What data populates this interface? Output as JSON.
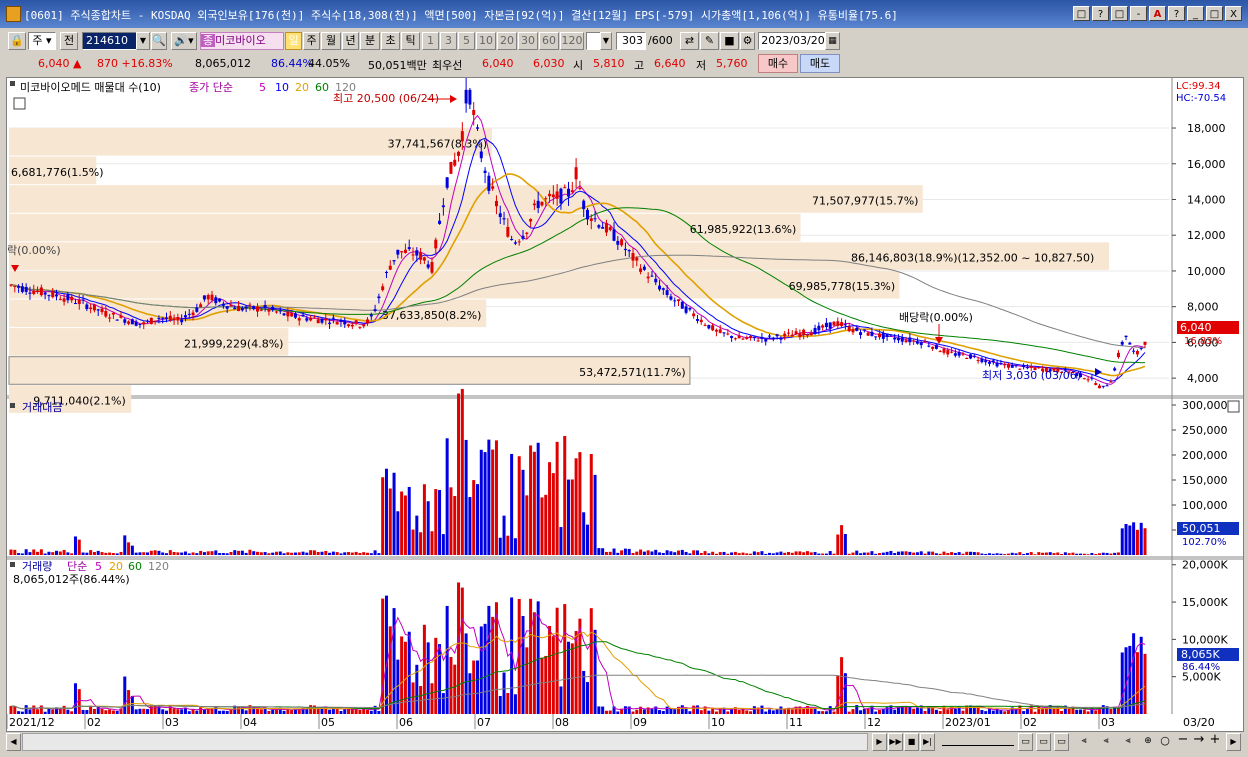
{
  "window": {
    "title": "[0601] 주식종합차트 - KOSDAQ 외국인보유[176(천)] 주식수[18,308(천)] 액면[500] 자본금[92(억)] 결산[12월] EPS[-579] 시가총액[1,106(억)] 유통비율[75.6]",
    "buttons": [
      "□",
      "?",
      "□",
      "-",
      "A",
      "?",
      "_",
      "□",
      "X"
    ]
  },
  "toolbar": {
    "period_select": "주",
    "prev_label": "전",
    "code": "214610",
    "stock_name": "미코바이오",
    "stock_prefix": "종",
    "tabs": [
      "일",
      "주",
      "월",
      "년",
      "분",
      "초",
      "틱"
    ],
    "intervals": [
      "1",
      "3",
      "5",
      "10",
      "20",
      "30",
      "60",
      "120"
    ],
    "count": "303",
    "count_total": "/600",
    "date": "2023/03/20"
  },
  "quote": {
    "price": "6,040",
    "arrow": "▲",
    "change": "870",
    "change_pct": "+16.83%",
    "volume": "8,065,012",
    "vol_ratio": "86.44%",
    "turnover": "44.05%",
    "amount": "50,051백만",
    "best_label": "최우선",
    "best_ask": "6,040",
    "best_bid": "6,030",
    "open_label": "시",
    "open": "5,810",
    "high_label": "고",
    "high": "6,640",
    "low_label": "저",
    "low": "5,760",
    "buy_label": "매수",
    "sell_label": "매도"
  },
  "chart_data": [
    {
      "type": "candlestick",
      "title": "미코바이오메드 매물대 수(10)",
      "legend": {
        "prefix": "종가 단순",
        "periods": [
          "5",
          "10",
          "20",
          "60",
          "120"
        ],
        "colors": [
          "#c000c0",
          "#0000ff",
          "#e0a000",
          "#008000",
          "#808080"
        ]
      },
      "y_ticks": [
        "18,000",
        "16,000",
        "14,000",
        "12,000",
        "10,000",
        "8,000",
        "6,000",
        "4,000"
      ],
      "ylim": [
        3000,
        20800
      ],
      "header_right": {
        "lc": "LC:99.34",
        "hc": "HC:-70.54"
      },
      "last_price": {
        "value": 6040,
        "label": "6,040",
        "pct": "16.83%"
      },
      "annotations": {
        "high": {
          "label": "최고 20,500 (06/24)",
          "value": 20500
        },
        "low": {
          "label": "최저 3,030 (03/06)",
          "value": 3030
        },
        "dividend": {
          "label": "배당락(0.00%)"
        },
        "left_marker": {
          "label": "락(0.00%)"
        }
      },
      "volume_profile": [
        {
          "low": 16400,
          "high": 18000,
          "label": "37,741,567(8.3%)"
        },
        {
          "low": 14800,
          "high": 16400,
          "label": "6,681,776(1.5%)"
        },
        {
          "low": 13200,
          "high": 14800,
          "label": "71,507,977(15.7%)"
        },
        {
          "low": 11600,
          "high": 13200,
          "label": "61,985,922(13.6%)"
        },
        {
          "low": 10000,
          "high": 11600,
          "label": "86,146,803(18.9%)(12,352.00 ~ 10,827.50)"
        },
        {
          "low": 8400,
          "high": 10000,
          "label": "69,985,778(15.3%)"
        },
        {
          "low": 6800,
          "high": 8400,
          "label": "37,633,850(8.2%)"
        },
        {
          "low": 5200,
          "high": 6800,
          "label": "21,999,229(4.8%)"
        },
        {
          "low": 3600,
          "high": 5200,
          "label": "53,472,571(11.7%)"
        },
        {
          "low": 2000,
          "high": 3600,
          "label": "9,711,040(2.1%)"
        }
      ],
      "x_labels": [
        "2021/12",
        "02",
        "03",
        "04",
        "05",
        "06",
        "07",
        "08",
        "09",
        "10",
        "11",
        "12",
        "2023/01",
        "02",
        "03",
        "03/20"
      ]
    },
    {
      "type": "bar",
      "title": "거래대금",
      "y_ticks": [
        "300,000",
        "250,000",
        "200,000",
        "150,000",
        "100,000",
        "50,000"
      ],
      "ylim": [
        0,
        310000
      ],
      "last_value": {
        "label": "50,051",
        "pct": "102.70%"
      }
    },
    {
      "type": "bar",
      "title": "거래량",
      "legend": {
        "prefix": "단순",
        "periods": [
          "5",
          "20",
          "60",
          "120"
        ],
        "colors": [
          "#c000c0",
          "#e0a000",
          "#008000",
          "#808080"
        ]
      },
      "subtitle": "8,065,012주(86.44%)",
      "y_ticks": [
        "20,000K",
        "15,000K",
        "10,000K",
        "5,000K"
      ],
      "ylim": [
        0,
        20500
      ],
      "last_value": {
        "label": "8,065K",
        "pct": "86.44%"
      }
    }
  ]
}
